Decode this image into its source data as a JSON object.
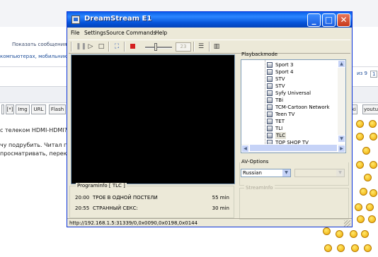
{
  "background_page": {
    "line_show_messages": "Показать сообщения за",
    "line_categories": "компьютерах, мобильниках и",
    "pagination": {
      "of_label": "из 9",
      "next_page": "1"
    },
    "bbcode_buttons": [
      "[*]",
      "Img",
      "URL",
      "Flash"
    ],
    "right_buttons": [
      "wiki",
      "youtu"
    ],
    "post_lines": [
      "с телеком HDMI-HDMI?[/q",
      "чу подрубить. Читал где",
      "просматривать, переклю"
    ]
  },
  "window": {
    "title": "DreamStream E1",
    "controls": {
      "minimize": "_",
      "maximize": "□",
      "close": "✕"
    },
    "menu": [
      "File",
      "Settings",
      "Source",
      "Commands",
      "Help"
    ],
    "toolbar": {
      "icons": [
        "pause-icon",
        "play-icon",
        "stop-icon",
        "fullscreen-icon",
        "record-icon",
        "volume-slider",
        "list-icon",
        "panel-icon"
      ],
      "volume_value": "23",
      "volume_level": 0.35
    },
    "programinfo": {
      "label": "Programinfo [ TLC ]",
      "rows": [
        {
          "time": "20:00",
          "title": "ТРОЕ В ОДНОЙ ПОСТЕЛИ",
          "duration": "55 min"
        },
        {
          "time": "20:55",
          "title": "СТРАННЫЙ СЕКС:",
          "duration": "30 min"
        }
      ]
    },
    "playbackmode": {
      "label": "Playbackmode",
      "channels": [
        "Sport 3",
        "Sport 4",
        "STV",
        "STV",
        "Syfy Universal",
        "TBi",
        "TCM-Cartoon Network",
        "Teen TV",
        "TET",
        "TLI",
        "TLC",
        "TOP SHOP TV"
      ],
      "selected": "TLC"
    },
    "av_options": {
      "label": "AV-Options",
      "audio_language": "Russian",
      "second_select": ""
    },
    "streaminfo": {
      "label": "StreamInfo"
    },
    "status": {
      "url": "http://192.168.1.5:31339/0,0x0090,0x0198,0x0144"
    },
    "colors": {
      "titlebar": "#0a5fe9",
      "face": "#ece9d8",
      "video": "#000000",
      "close": "#c8391a"
    }
  }
}
